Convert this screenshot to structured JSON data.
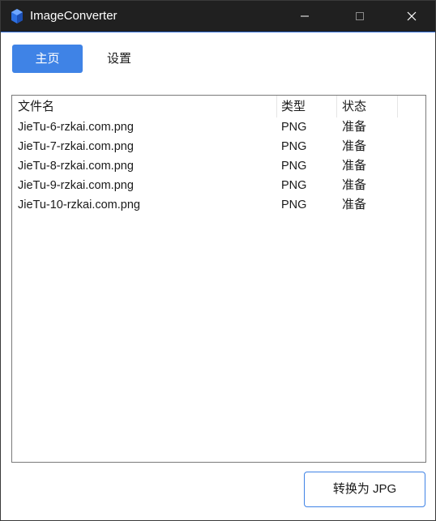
{
  "window": {
    "title": "ImageConverter"
  },
  "tabs": [
    {
      "label": "主页"
    },
    {
      "label": "设置"
    }
  ],
  "table": {
    "columns": [
      "文件名",
      "类型",
      "状态"
    ],
    "rows": [
      {
        "name": "JieTu-6-rzkai.com.png",
        "type": "PNG",
        "status": "准备"
      },
      {
        "name": "JieTu-7-rzkai.com.png",
        "type": "PNG",
        "status": "准备"
      },
      {
        "name": "JieTu-8-rzkai.com.png",
        "type": "PNG",
        "status": "准备"
      },
      {
        "name": "JieTu-9-rzkai.com.png",
        "type": "PNG",
        "status": "准备"
      },
      {
        "name": "JieTu-10-rzkai.com.png",
        "type": "PNG",
        "status": "准备"
      }
    ]
  },
  "actions": {
    "convert_label": "转换为 JPG"
  },
  "colors": {
    "accent": "#3f83e6",
    "titlebar": "#202020"
  }
}
